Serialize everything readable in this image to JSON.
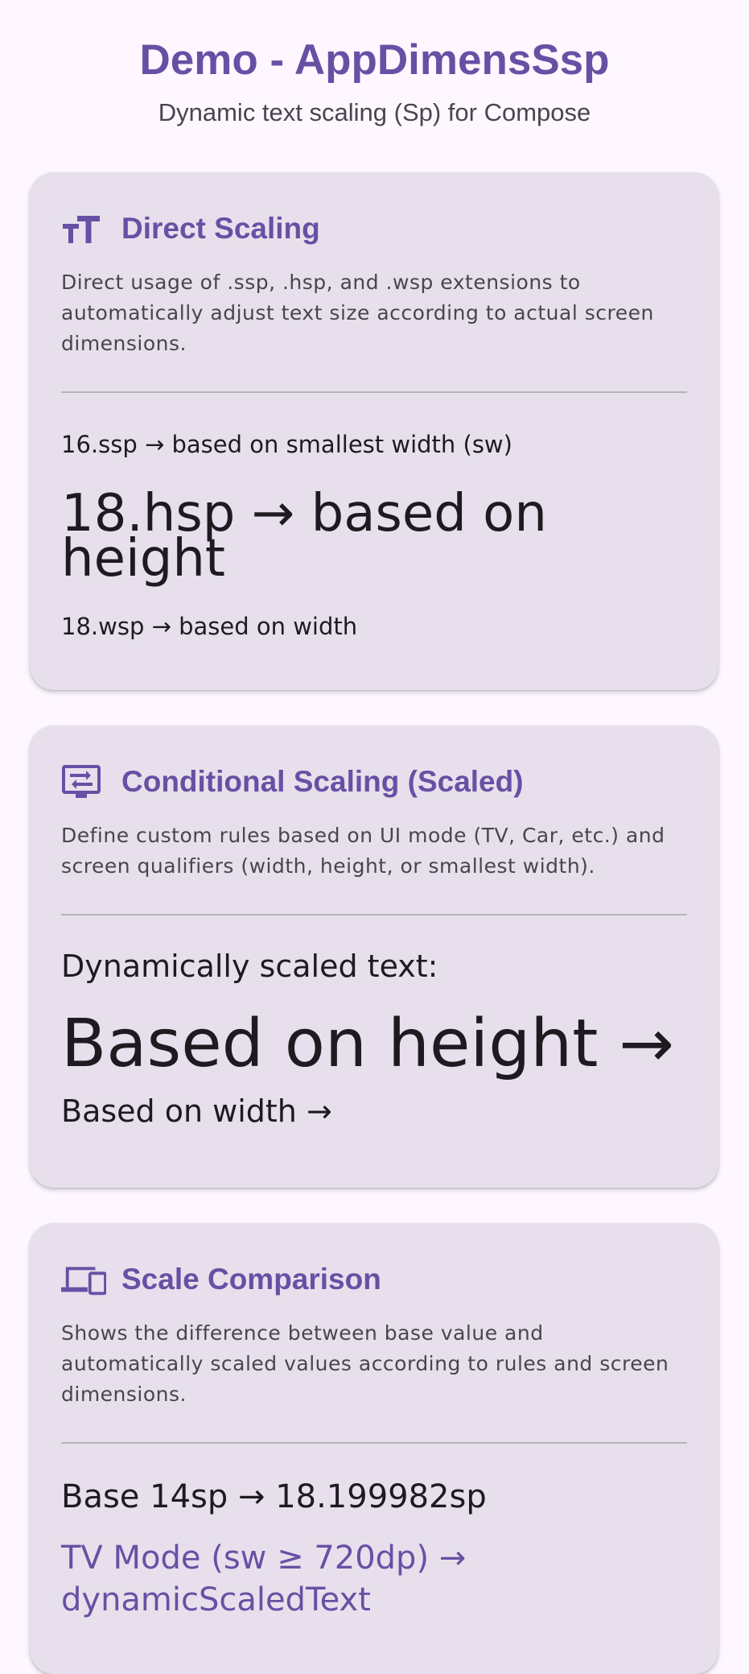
{
  "header": {
    "title": "Demo - AppDimensSsp",
    "subtitle": "Dynamic text scaling (Sp) for Compose"
  },
  "colors": {
    "background": "#fef7ff",
    "card": "#e7e0ec",
    "primary": "#6750a4",
    "text": "#1d1b20",
    "muted": "#49454f",
    "divider": "#b8b2bd"
  },
  "cards": [
    {
      "icon": "text-fields-icon",
      "title": "Direct Scaling",
      "description": "Direct usage of .ssp, .hsp, and .wsp extensions to automatically adjust text size according to actual screen dimensions.",
      "lines": [
        "16.ssp → based on smallest width (sw)",
        "18.hsp → based on height",
        "18.wsp → based on width"
      ]
    },
    {
      "icon": "settings-input-component-icon",
      "title": "Conditional Scaling (Scaled)",
      "description": "Define custom rules based on UI mode (TV, Car, etc.) and screen qualifiers (width, height, or smallest width).",
      "lines": [
        "Dynamically scaled text:",
        "Based on height →",
        "Based on width →"
      ]
    },
    {
      "icon": "devices-icon",
      "title": "Scale Comparison",
      "description": "Shows the difference between base value and automatically scaled values according to rules and screen dimensions.",
      "lines": [
        "Base 14sp → 18.199982sp",
        "TV Mode (sw ≥ 720dp) →",
        "dynamicScaledText"
      ]
    }
  ]
}
